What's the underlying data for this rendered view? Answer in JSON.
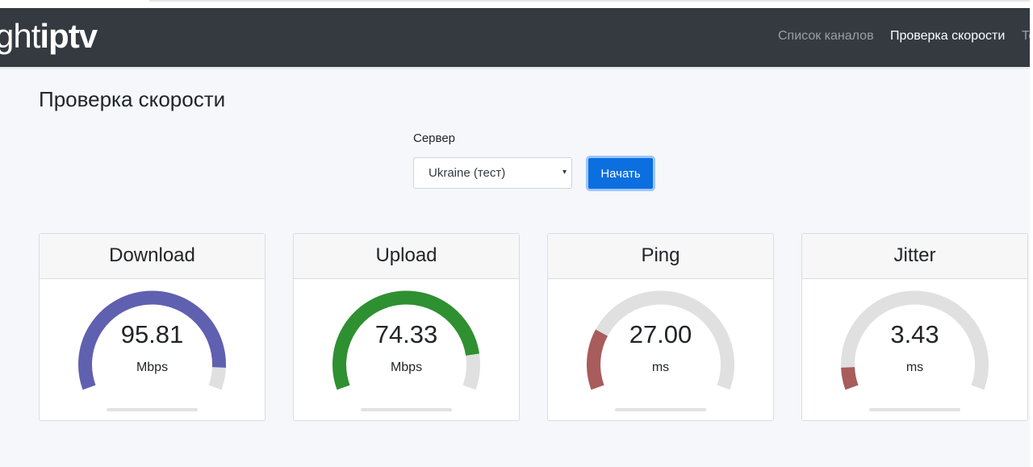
{
  "navbar": {
    "brand_light": "ght",
    "brand_bold": "iptv",
    "links": [
      "Список каналов",
      "Проверка скорости",
      "То"
    ]
  },
  "page": {
    "title": "Проверка скорости"
  },
  "server": {
    "label": "Сервер",
    "selected": "Ukraine (тест)",
    "arrow_glyph": "▾",
    "start_label": "Начать"
  },
  "metrics": [
    {
      "name": "Download",
      "value": "95.81",
      "unit": "Mbps",
      "fraction": 0.92,
      "color": "#6060b0"
    },
    {
      "name": "Upload",
      "value": "74.33",
      "unit": "Mbps",
      "fraction": 0.87,
      "color": "#2e9030"
    },
    {
      "name": "Ping",
      "value": "27.00",
      "unit": "ms",
      "fraction": 0.22,
      "color": "#a85c5c"
    },
    {
      "name": "Jitter",
      "value": "3.43",
      "unit": "ms",
      "fraction": 0.08,
      "color": "#a85c5c"
    }
  ],
  "colors": {
    "navbar_bg": "#343a40",
    "gauge_track": "#e0e0e0",
    "button_bg": "#0b6fe0"
  }
}
